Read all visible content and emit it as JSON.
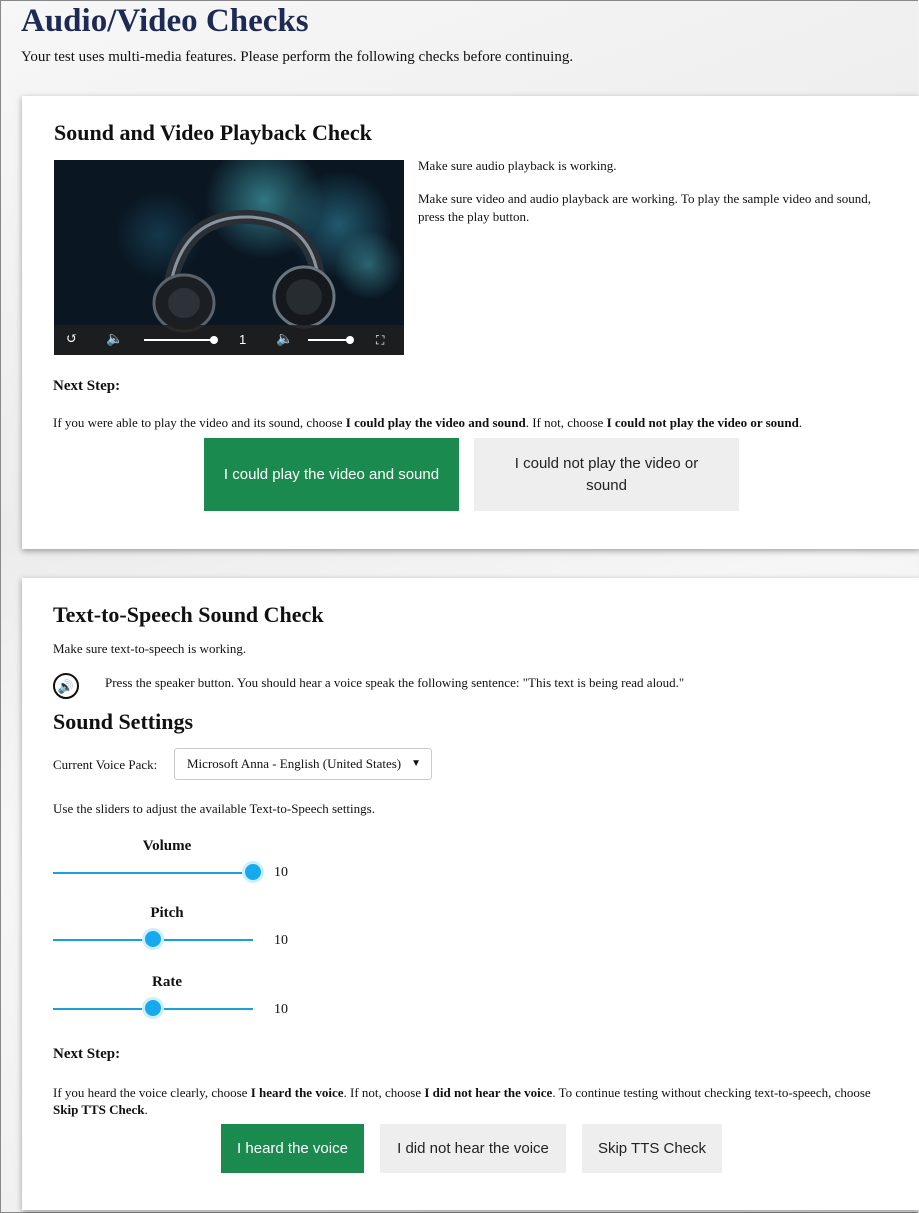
{
  "page": {
    "title": "Audio/Video Checks",
    "intro": "Your test uses multi-media features. Please perform the following checks before continuing."
  },
  "av_check": {
    "heading": "Sound and Video Playback Check",
    "audio_note": "Make sure audio playback is working.",
    "video_note": "Make sure video and audio playback are working. To play the sample video and sound, press the play button.",
    "player": {
      "icons": [
        "replay-icon",
        "volume-icon",
        "volume-icon",
        "fullscreen-icon"
      ],
      "playback_rate": "1",
      "volume_level": 1.0,
      "progress": 1.0
    },
    "next_step_label": "Next Step:",
    "instruction": {
      "t1": "If you were able to play the video and its sound, choose ",
      "b1": "I could play the video and sound",
      "t2": ". If not, choose ",
      "b2": "I could not play the video or sound",
      "t3": "."
    },
    "buttons": {
      "yes": "I could play the video and sound",
      "no": "I could not play the video or sound"
    }
  },
  "tts_check": {
    "heading": "Text-to-Speech Sound Check",
    "note": "Make sure text-to-speech is working.",
    "speaker_instruction": "Press the speaker button. You should hear a voice speak the following sentence: \"This text is being read aloud.\"",
    "settings_heading": "Sound Settings",
    "voice_pack_label": "Current Voice Pack:",
    "voice_pack_value": "Microsoft Anna - English (United States)",
    "sliders_note": "Use the sliders to adjust the available Text-to-Speech settings.",
    "sliders": [
      {
        "label": "Volume",
        "value": "10",
        "position": 1.0
      },
      {
        "label": "Pitch",
        "value": "10",
        "position": 0.5
      },
      {
        "label": "Rate",
        "value": "10",
        "position": 0.5
      }
    ],
    "next_step_label": "Next Step:",
    "instruction": {
      "t1": "If you heard the voice clearly, choose ",
      "b1": "I heard the voice",
      "t2": ". If not, choose ",
      "b2": "I did not hear the voice",
      "t3": ". To continue testing without checking text-to-speech, choose ",
      "b3": "Skip TTS Check",
      "t4": "."
    },
    "buttons": {
      "heard": "I heard the voice",
      "not_heard": "I did not hear the voice",
      "skip": "Skip TTS Check"
    }
  },
  "colors": {
    "title": "#1d2a56",
    "primary_button": "#1a8a4e",
    "secondary_button": "#eeeeee",
    "slider": "#17a9ee"
  }
}
